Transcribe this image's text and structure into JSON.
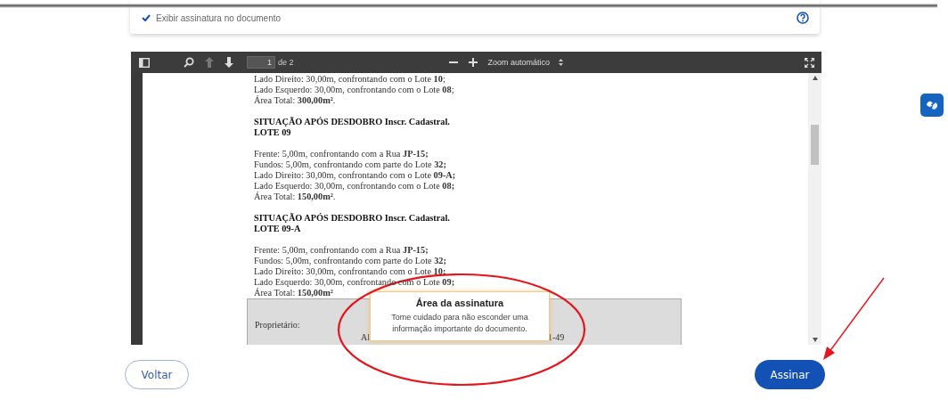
{
  "options_card": {
    "checkbox": {
      "label": "Exibir assinatura no documento",
      "checked": true
    }
  },
  "pdf_viewer": {
    "toolbar": {
      "page_input": "1",
      "page_count": "de 2",
      "zoom_select": "Zoom automático"
    },
    "document": {
      "blocks": [
        {
          "kind": "lines",
          "lines": [
            "Lado Direito: 30,00m, confrontando com o Lote **10**;",
            "Lado Esquerdo: 30,00m, confrontando com o Lote **08**;",
            "Área Total: **300,00m²**."
          ]
        },
        {
          "kind": "heading",
          "lines": [
            "SITUAÇÃO APÓS DESDOBRO  Inscr. Cadastral.",
            "LOTE 09"
          ]
        },
        {
          "kind": "lines",
          "lines": [
            "Frente: 5,00m, confrontando com a Rua **JP-15;**",
            "Fundos: 5,00m, confrontando com parte do Lote **32;**",
            "Lado Direito: 30,00m, confrontando com o Lote **09-A;**",
            "Lado Esquerdo: 30,00m, confrontando com o Lote **08;**",
            "Área Total: **150,00m²**."
          ]
        },
        {
          "kind": "heading",
          "lines": [
            "SITUAÇÃO APÓS DESDOBRO  Inscr. Cadastral.",
            "LOTE 09-A"
          ]
        },
        {
          "kind": "lines",
          "lines": [
            "Frente: 5,00m, confrontando com a Rua **JP-15;**",
            "Fundos: 5,00m, confrontando com parte do Lote **32;**",
            "Lado Direito: 30,00m, confrontando com o Lote **10;**",
            "Lado Esquerdo: 30,00m, confrontando com o Lote **09;**",
            "Área Total: **150,00m²**"
          ]
        }
      ],
      "signature_box": {
        "label": "Proprietário:",
        "fragment_left": "Al",
        "fragment_right": "1-49"
      }
    }
  },
  "tooltip": {
    "title": "Área da assinatura",
    "text": "Tome cuidado para não esconder uma informação importante do documento."
  },
  "buttons": [
    {
      "kind": "secondary",
      "label": "Voltar"
    },
    {
      "kind": "primary",
      "label": "Assinar"
    }
  ]
}
